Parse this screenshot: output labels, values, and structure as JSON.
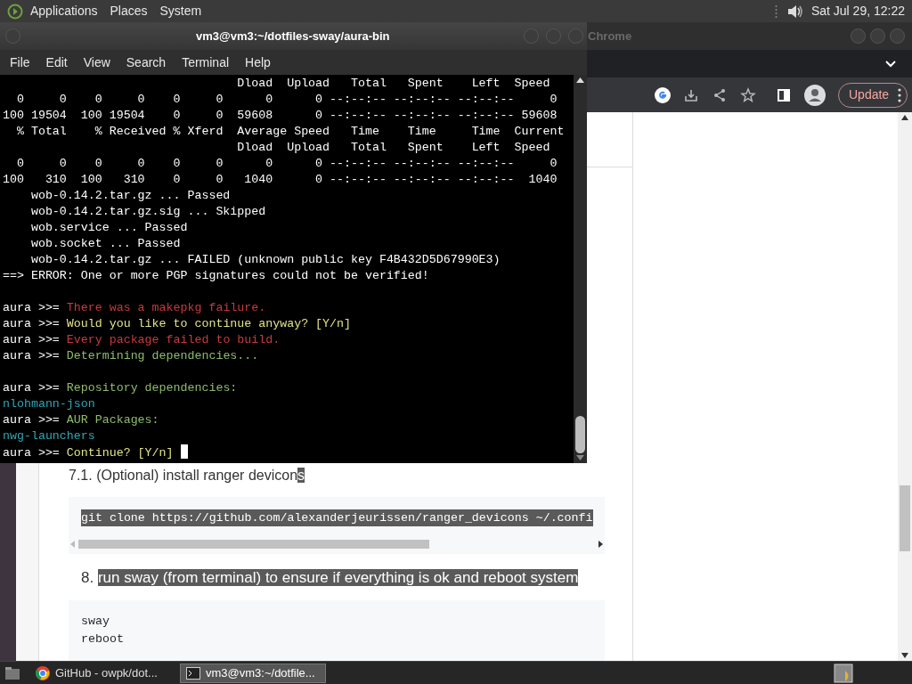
{
  "top_panel": {
    "menus": [
      "Applications",
      "Places",
      "System"
    ],
    "clock": "Sat Jul 29, 12:22"
  },
  "browser_window": {
    "title": "Chrome",
    "update_button": "Update",
    "page": {
      "items": [
        {
          "kind": "heading",
          "number": "7.1.",
          "parts": [
            {
              "text": "(Optional) install ranger devicon",
              "selected": false
            },
            {
              "text": "s",
              "selected": true
            }
          ]
        },
        {
          "kind": "code",
          "selected": true,
          "scrollbar": true,
          "lines": [
            "git clone https://github.com/alexanderjeurissen/ranger_devicons ~/.confi"
          ]
        },
        {
          "kind": "step",
          "number": "8.",
          "parts": [
            {
              "text": "run sway (from terminal) to ensure if everything is ok and reboot system",
              "selected": true
            }
          ]
        },
        {
          "kind": "code",
          "selected": false,
          "lines": [
            "sway",
            "reboot"
          ]
        }
      ]
    }
  },
  "terminal_window": {
    "title": "vm3@vm3:~/dotfiles-sway/aura-bin",
    "menu": [
      "File",
      "Edit",
      "View",
      "Search",
      "Terminal",
      "Help"
    ],
    "lines": [
      {
        "segments": [
          {
            "text": "                                 Dload  Upload   Total   Spent    Left  Speed",
            "color": "#ffffff"
          }
        ]
      },
      {
        "segments": [
          {
            "text": "  0     0    0     0    0     0      0      0 --:--:-- --:--:-- --:--:--     0",
            "color": "#ffffff"
          }
        ]
      },
      {
        "segments": [
          {
            "text": "100 19504  100 19504    0     0  59608      0 --:--:-- --:--:-- --:--:-- 59608",
            "color": "#ffffff"
          }
        ]
      },
      {
        "segments": [
          {
            "text": "  % Total    % Received % Xferd  Average Speed   Time    Time     Time  Current",
            "color": "#ffffff"
          }
        ]
      },
      {
        "segments": [
          {
            "text": "                                 Dload  Upload   Total   Spent    Left  Speed",
            "color": "#ffffff"
          }
        ]
      },
      {
        "segments": [
          {
            "text": "  0     0    0     0    0     0      0      0 --:--:-- --:--:-- --:--:--     0",
            "color": "#ffffff"
          }
        ]
      },
      {
        "segments": [
          {
            "text": "100   310  100   310    0     0   1040      0 --:--:-- --:--:-- --:--:--  1040",
            "color": "#ffffff"
          }
        ]
      },
      {
        "segments": [
          {
            "text": "    wob-0.14.2.tar.gz ... Passed",
            "color": "#ffffff"
          }
        ]
      },
      {
        "segments": [
          {
            "text": "    wob-0.14.2.tar.gz.sig ... Skipped",
            "color": "#ffffff"
          }
        ]
      },
      {
        "segments": [
          {
            "text": "    wob.service ... Passed",
            "color": "#ffffff"
          }
        ]
      },
      {
        "segments": [
          {
            "text": "    wob.socket ... Passed",
            "color": "#ffffff"
          }
        ]
      },
      {
        "segments": [
          {
            "text": "    wob-0.14.2.tar.gz ... FAILED (unknown public key F4B432D5D67990E3)",
            "color": "#ffffff"
          }
        ]
      },
      {
        "segments": [
          {
            "text": "==> ERROR: One or more PGP signatures could not be verified!",
            "color": "#ffffff"
          }
        ]
      },
      {
        "gap_before": true,
        "segments": [
          {
            "text": "aura >>= ",
            "color": "#ffffff"
          },
          {
            "text": "There was a makepkg failure.",
            "color": "#c83a3a"
          }
        ]
      },
      {
        "segments": [
          {
            "text": "aura >>= ",
            "color": "#ffffff"
          },
          {
            "text": "Would you like to continue anyway? [Y/n]",
            "color": "#e3e38a"
          }
        ]
      },
      {
        "segments": [
          {
            "text": "aura >>= ",
            "color": "#ffffff"
          },
          {
            "text": "Every package failed to build.",
            "color": "#c83a3a"
          }
        ]
      },
      {
        "segments": [
          {
            "text": "aura >>= ",
            "color": "#ffffff"
          },
          {
            "text": "Determining dependencies...",
            "color": "#8fbc6a"
          }
        ]
      },
      {
        "gap_before": true,
        "segments": [
          {
            "text": "aura >>= ",
            "color": "#ffffff"
          },
          {
            "text": "Repository dependencies:",
            "color": "#8fbc6a"
          }
        ]
      },
      {
        "segments": [
          {
            "text": "nlohmann-json",
            "color": "#2ea7b5"
          }
        ]
      },
      {
        "segments": [
          {
            "text": "aura >>= ",
            "color": "#ffffff"
          },
          {
            "text": "AUR Packages:",
            "color": "#8fbc6a"
          }
        ]
      },
      {
        "segments": [
          {
            "text": "nwg-launchers",
            "color": "#2ea7b5"
          }
        ]
      },
      {
        "segments": [
          {
            "text": "aura >>= ",
            "color": "#ffffff"
          },
          {
            "text": "Continue? [Y/n]",
            "color": "#e3e38a"
          }
        ],
        "cursor": true
      }
    ]
  },
  "taskbar": {
    "tasks": [
      {
        "kind": "browser",
        "label": "GitHub - owpk/dot...",
        "selected": false
      },
      {
        "kind": "terminal",
        "label": "vm3@vm3:~/dotfile...",
        "selected": true
      }
    ]
  }
}
